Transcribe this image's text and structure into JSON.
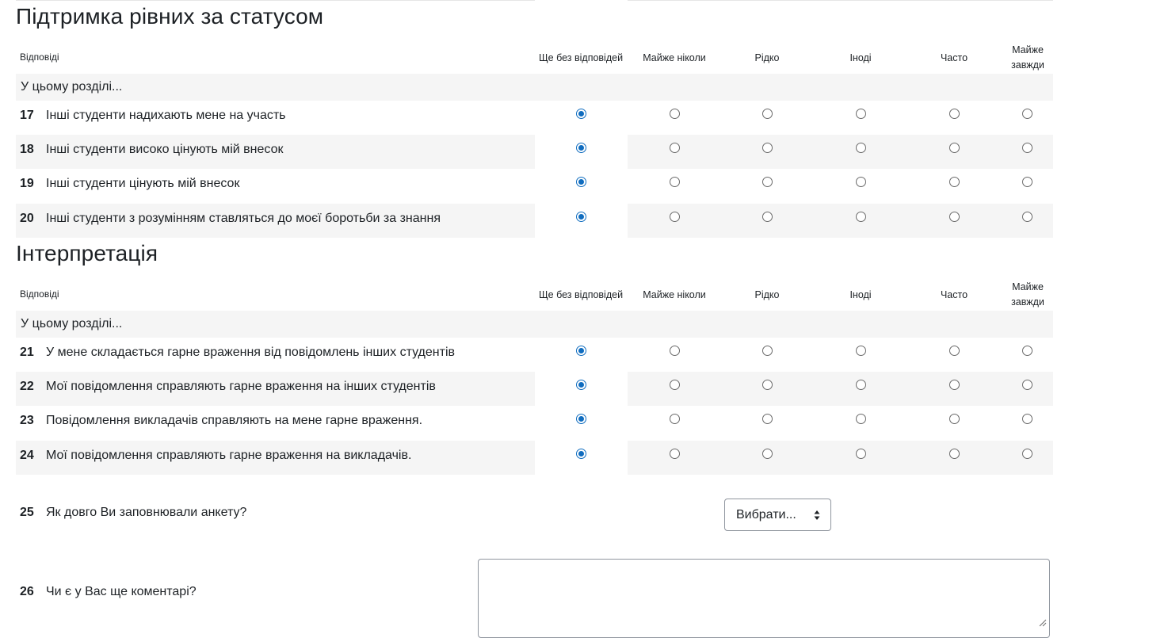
{
  "colors": {
    "accent": "#0f6cbf",
    "row_shade": "#f5f5f5",
    "text": "#1d2125",
    "border": "#8f959e"
  },
  "sections": [
    {
      "title": "Підтримка рівних за статусом",
      "answers_label": "Відповіді",
      "columns": [
        "Ще без відповідей",
        "Майже ніколи",
        "Рідко",
        "Іноді",
        "Часто",
        "Майже завжди"
      ],
      "intro": "У цьому розділі...",
      "questions": [
        {
          "num": "17",
          "text": "Інші студенти надихають мене на участь",
          "selected": "Ще без відповідей"
        },
        {
          "num": "18",
          "text": "Інші студенти високо цінують мій внесок",
          "selected": "Ще без відповідей"
        },
        {
          "num": "19",
          "text": "Інші студенти цінують мій внесок",
          "selected": "Ще без відповідей"
        },
        {
          "num": "20",
          "text": "Інші студенти з розумінням ставляться до моєї боротьби за знання",
          "selected": "Ще без відповідей"
        }
      ]
    },
    {
      "title": "Інтерпретація",
      "answers_label": "Відповіді",
      "columns": [
        "Ще без відповідей",
        "Майже ніколи",
        "Рідко",
        "Іноді",
        "Часто",
        "Майже завжди"
      ],
      "intro": "У цьому розділі...",
      "questions": [
        {
          "num": "21",
          "text": "У мене складається гарне враження від повідомлень інших студентів",
          "selected": "Ще без відповідей"
        },
        {
          "num": "22",
          "text": "Мої повідомлення справляють гарне враження на інших студентів",
          "selected": "Ще без відповідей"
        },
        {
          "num": "23",
          "text": "Повідомлення викладачів справляють на мене гарне враження.",
          "selected": "Ще без відповідей"
        },
        {
          "num": "24",
          "text": "Мої повідомлення справляють гарне враження на викладачів.",
          "selected": "Ще без відповідей"
        }
      ]
    }
  ],
  "q25": {
    "num": "25",
    "text": "Як довго Ви заповнювали анкету?",
    "select_value": "Вибрати...",
    "icon": "select-caret-icon"
  },
  "q26": {
    "num": "26",
    "text": "Чи є у Вас ще коментарі?",
    "comment_value": "",
    "icon": "resize-grip-icon"
  }
}
